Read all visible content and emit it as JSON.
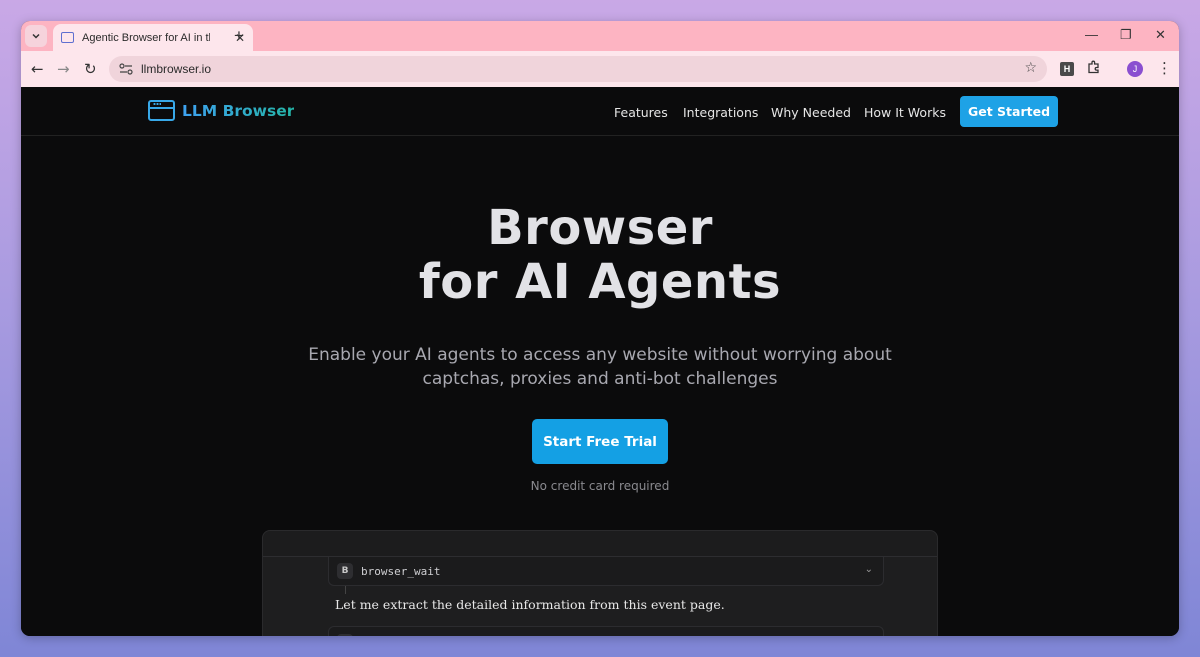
{
  "browser": {
    "tab_title": "Agentic Browser for AI in the Cl",
    "url": "llmbrowser.io",
    "profile_initial": "J",
    "extension_letter": "H",
    "icons": {
      "tab_search": "chevron-down-icon",
      "new_tab": "plus-icon",
      "back": "back-arrow-icon",
      "forward": "forward-arrow-icon",
      "reload": "reload-icon",
      "bookmark": "star-icon",
      "extensions": "puzzle-icon",
      "menu": "kebab-icon"
    }
  },
  "site": {
    "logo_text": "LLM Browser",
    "nav": [
      {
        "label": "Features"
      },
      {
        "label": "Integrations"
      },
      {
        "label": "Why Needed"
      },
      {
        "label": "How It Works"
      }
    ],
    "cta_nav": "Get Started",
    "colors": {
      "accent": "#1ea2e6",
      "logo_gradient_start": "#3ea1f0",
      "logo_gradient_end": "#25b5a8",
      "background": "#0b0b0c"
    }
  },
  "hero": {
    "title_line1": "Browser",
    "title_line2": "for AI Agents",
    "subtitle_line1": "Enable your AI agents to access any website without worrying about",
    "subtitle_line2": "captchas, proxies and anti-bot challenges",
    "cta_label": "Start Free Trial",
    "cta_note": "No credit card required"
  },
  "demo": {
    "tool_badge": "B",
    "tool_name": "browser_wait",
    "message": "Let me extract the detailed information from this event page."
  }
}
